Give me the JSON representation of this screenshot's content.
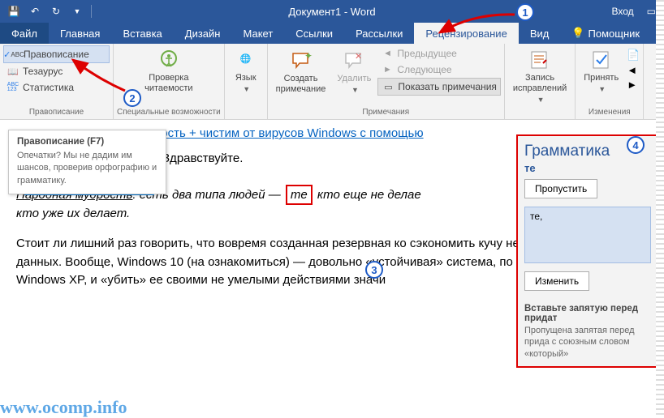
{
  "title": "Документ1 - Word",
  "login": "Вход",
  "tabs": {
    "file": "Файл",
    "home": "Главная",
    "insert": "Вставка",
    "design": "Дизайн",
    "layout": "Макет",
    "references": "Ссылки",
    "mailings": "Рассылки",
    "review": "Рецензирование",
    "view": "Вид",
    "help": "Помощник"
  },
  "ribbon": {
    "proofing": {
      "spelling": "Правописание",
      "thesaurus": "Тезаурус",
      "stats": "Статистика",
      "group": "Правописание"
    },
    "accessibility": {
      "check": "Проверка\nчитаемости",
      "group": "Специальные возможности"
    },
    "language": {
      "label": "Язык"
    },
    "comments": {
      "new": "Создать\nпримечание",
      "delete": "Удалить",
      "prev": "Предыдущее",
      "next": "Следующее",
      "show": "Показать примечания",
      "group": "Примечания"
    },
    "tracking": {
      "track": "Запись\nисправлений",
      "accept": "Принять"
    },
    "changes": {
      "group": "Изменения"
    }
  },
  "tooltip": {
    "title": "Правописание (F7)",
    "body": "Опечатки? Мы не дадим им шансов, проверив орфографию и грамматику."
  },
  "doc": {
    "heading_suffix": "ность + чистим от вирусов Windows с помощью",
    "win10": "Windows 10",
    "greeting": "Здравствуйте.",
    "p1_lead": "Народная мудрость",
    "p1_mid1": ": есть два типа людей — ",
    "p1_err": "те",
    "p1_mid2": " кто еще не делае",
    "p1_end": "кто уже их делает.",
    "p2": "Стоит ли лишний раз говорить, что вовремя созданная резервная ко сэкономить кучу нервов, времени и данных. Вообще, Windows 10 (на ознакомиться) — довольно «устойчивая» система, по крайней мере же Windows XP, и «убить» ее своими не умелыми действиями значи"
  },
  "pane": {
    "title": "Грамматика",
    "word": "те",
    "skip": "Пропустить",
    "suggestion": "те,",
    "change": "Изменить",
    "help_title": "Вставьте запятую перед придат",
    "help_body": "Пропущена запятая перед прида с союзным словом «который»"
  },
  "watermark": "www.ocomp.info"
}
